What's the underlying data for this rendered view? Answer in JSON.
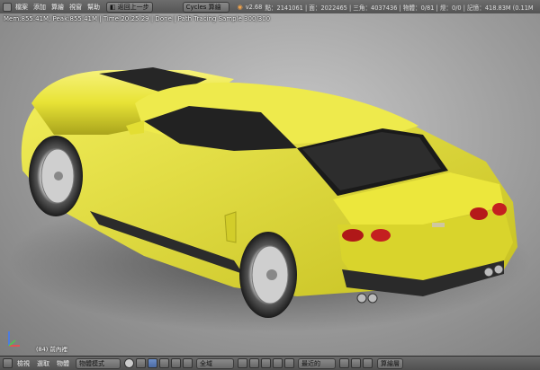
{
  "topbar": {
    "menus": [
      "檔案",
      "添加",
      "算繪",
      "視窗",
      "幫助"
    ],
    "undo_label": "返回上一步",
    "engine": "Cycles 算繪",
    "version": "v2.68",
    "stats": "點：2141061 | 面：2022465 | 三角：4037436 | 物體：0/81 | 燈：0/0 | 記憶：418.83M (0.11M"
  },
  "viewport": {
    "render_info": "Mem:855.41M, Peak:855.41M | Time:20:25.29 | Done | Path Tracing Sample 300/300",
    "object_label": "(84) 前內裡"
  },
  "bottombar": {
    "menus": [
      "檢視",
      "選取",
      "物體"
    ],
    "mode": "物體模式",
    "orientation": "全域",
    "pivot": "最近的",
    "render_button": "算繪層"
  },
  "colors": {
    "car_body": "#e8e336",
    "header_bg": "#5e5e5e",
    "active_tool": "#5577b2"
  }
}
